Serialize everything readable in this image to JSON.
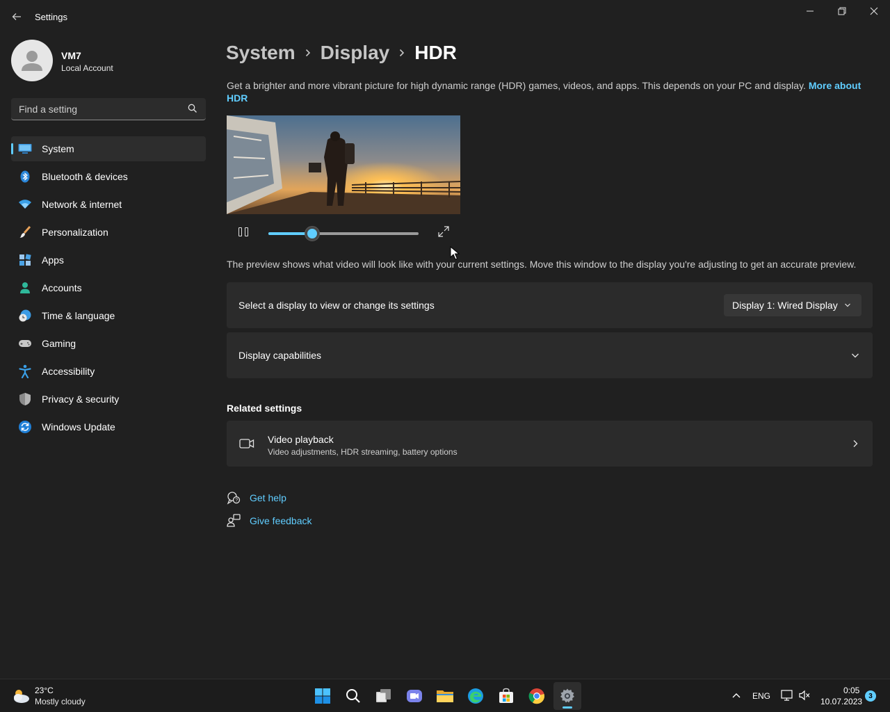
{
  "window": {
    "title": "Settings"
  },
  "profile": {
    "name": "VM7",
    "account_type": "Local Account"
  },
  "search": {
    "placeholder": "Find a setting"
  },
  "sidebar": {
    "items": [
      {
        "label": "System",
        "icon": "system-icon",
        "active": true
      },
      {
        "label": "Bluetooth & devices",
        "icon": "bluetooth-icon"
      },
      {
        "label": "Network & internet",
        "icon": "wifi-icon"
      },
      {
        "label": "Personalization",
        "icon": "brush-icon"
      },
      {
        "label": "Apps",
        "icon": "apps-icon"
      },
      {
        "label": "Accounts",
        "icon": "person-icon"
      },
      {
        "label": "Time & language",
        "icon": "clock-globe-icon"
      },
      {
        "label": "Gaming",
        "icon": "gamepad-icon"
      },
      {
        "label": "Accessibility",
        "icon": "accessibility-icon"
      },
      {
        "label": "Privacy & security",
        "icon": "shield-icon"
      },
      {
        "label": "Windows Update",
        "icon": "update-icon"
      }
    ]
  },
  "breadcrumb": {
    "items": [
      "System",
      "Display",
      "HDR"
    ]
  },
  "main": {
    "description": "Get a brighter and more vibrant picture for high dynamic range (HDR) games, videos, and apps. This depends on your PC and display.",
    "more_link": "More about HDR",
    "preview": {
      "progress": 0.29
    },
    "preview_note": "The preview shows what video will look like with your current settings. Move this window to the display you're adjusting to get an accurate preview.",
    "select_display_label": "Select a display to view or change its settings",
    "display_dropdown_value": "Display 1: Wired Display",
    "display_capabilities_label": "Display capabilities",
    "related_title": "Related settings",
    "video_playback": {
      "title": "Video playback",
      "subtitle": "Video adjustments, HDR streaming, battery options"
    },
    "get_help": "Get help",
    "give_feedback": "Give feedback"
  },
  "taskbar": {
    "weather_temp": "23°C",
    "weather_condition": "Mostly cloudy",
    "language": "ENG",
    "time": "0:05",
    "date": "10.07.2023",
    "notification_count": "3",
    "accent": "#60cdff"
  }
}
